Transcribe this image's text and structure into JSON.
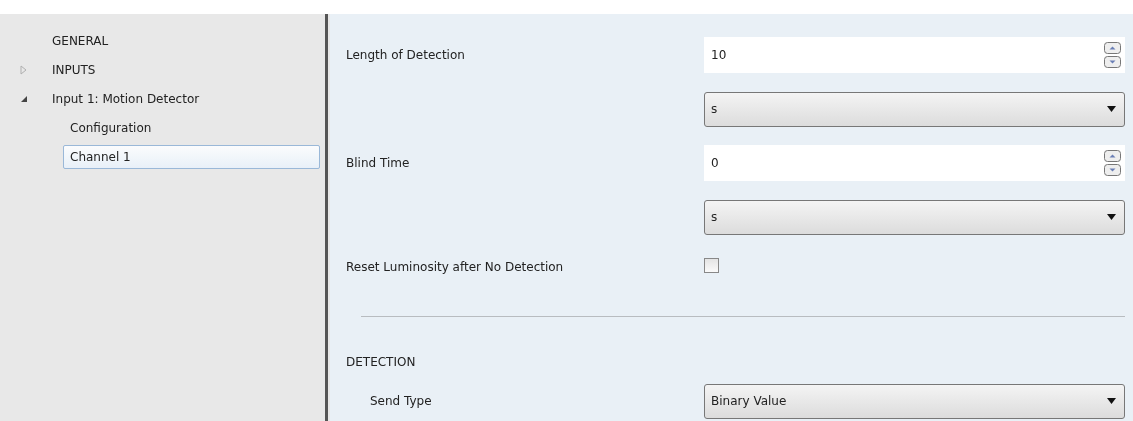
{
  "tree": [
    {
      "label": "GENERAL"
    },
    {
      "label": "INPUTS",
      "expanded": false
    },
    {
      "label": "Input 1: Motion Detector",
      "expanded": true,
      "children": [
        {
          "label": "Configuration",
          "selected": false
        },
        {
          "label": "Channel 1",
          "selected": true
        }
      ]
    }
  ],
  "rows": [
    {
      "kind": "spin",
      "label": "Length of Detection",
      "value": "10"
    },
    {
      "kind": "dropdown",
      "value": "s"
    },
    {
      "kind": "spin",
      "label": "Blind Time",
      "value": "0"
    },
    {
      "kind": "dropdown",
      "value": "s"
    },
    {
      "kind": "checkbox",
      "label": "Reset Luminosity after No Detection",
      "checked": false
    },
    {
      "kind": "separator"
    },
    {
      "kind": "heading",
      "label": "DETECTION"
    },
    {
      "kind": "dropdown",
      "label": "Send Type",
      "value": "Binary Value",
      "indented": true
    }
  ]
}
